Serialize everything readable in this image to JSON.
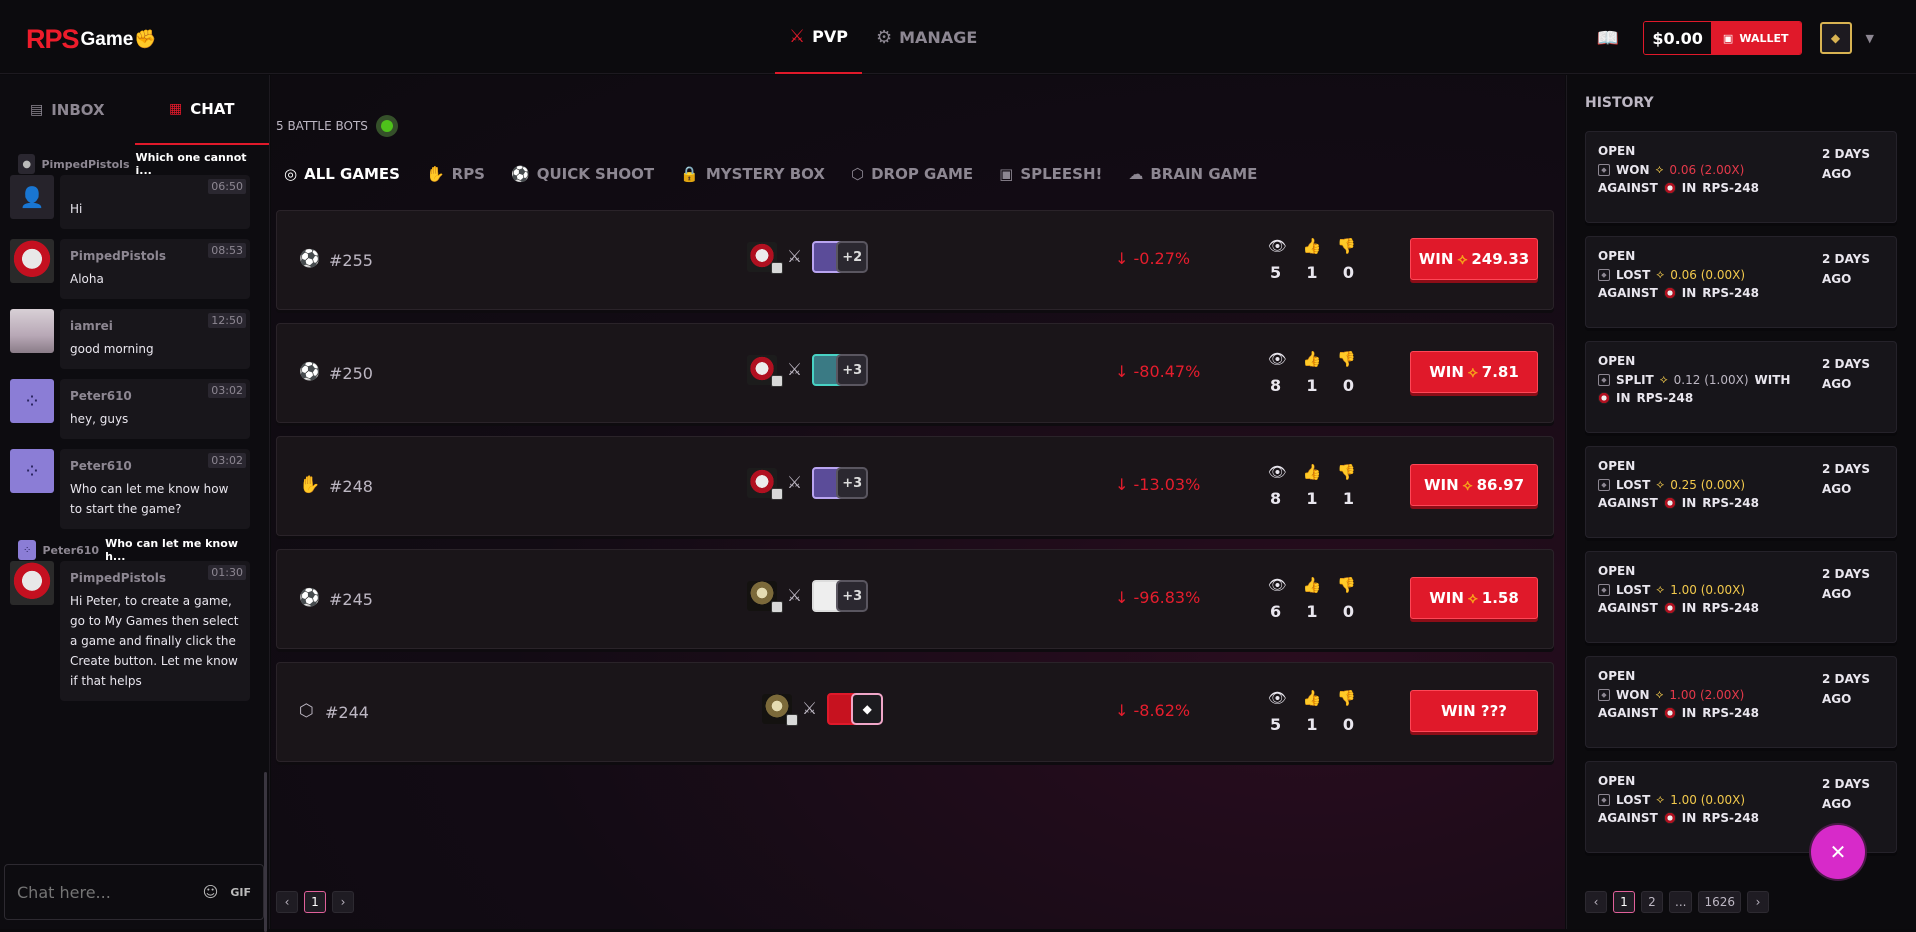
{
  "logo": {
    "rps": "RPS",
    "game": "Game"
  },
  "nav": {
    "pvp": "PVP",
    "manage": "MANAGE"
  },
  "wallet": {
    "balance": "$0.00",
    "label": "WALLET"
  },
  "left": {
    "tabs": {
      "inbox": "INBOX",
      "chat": "CHAT"
    },
    "messages": [
      {
        "reply_name": "PimpedPistols",
        "reply_text": "Which one cannot i...",
        "name": "",
        "text": "Hi",
        "time": "06:50",
        "avatar": "gray"
      },
      {
        "name": "PimpedPistols",
        "text": "Aloha",
        "time": "08:53",
        "avatar": "rb"
      },
      {
        "name": "iamrei",
        "text": "good morning",
        "time": "12:50",
        "avatar": "photo"
      },
      {
        "name": "Peter610",
        "text": "hey, guys",
        "time": "03:02",
        "avatar": "purple"
      },
      {
        "name": "Peter610",
        "text": "Who can let me know how to start the game?",
        "time": "03:02",
        "avatar": "purple"
      },
      {
        "reply_name": "Peter610",
        "reply_text": "Who can let me know h...",
        "name": "PimpedPistols",
        "text": "Hi Peter, to create a game, go to My Games then select a game and finally click the Create button. Let me know if that helps",
        "time": "01:30",
        "avatar": "rb"
      }
    ],
    "input_placeholder": "Chat here...",
    "gif": "GIF"
  },
  "main": {
    "bots_label": "5 BATTLE BOTS",
    "tabs": [
      "ALL GAMES",
      "RPS",
      "QUICK SHOOT",
      "MYSTERY BOX",
      "DROP GAME",
      "SPLEESH!",
      "BRAIN GAME"
    ],
    "games": [
      {
        "id": "#255",
        "more": "+2",
        "pct": "-0.27%",
        "views": "5",
        "likes": "1",
        "dislikes": "0",
        "win": "WIN",
        "amount": "249.33"
      },
      {
        "id": "#250",
        "more": "+3",
        "pct": "-80.47%",
        "views": "8",
        "likes": "1",
        "dislikes": "0",
        "win": "WIN",
        "amount": "7.81"
      },
      {
        "id": "#248",
        "more": "+3",
        "pct": "-13.03%",
        "views": "8",
        "likes": "1",
        "dislikes": "1",
        "win": "WIN",
        "amount": "86.97"
      },
      {
        "id": "#245",
        "more": "+3",
        "pct": "-96.83%",
        "views": "6",
        "likes": "1",
        "dislikes": "0",
        "win": "WIN",
        "amount": "1.58"
      },
      {
        "id": "#244",
        "more": "",
        "pct": "-8.62%",
        "views": "5",
        "likes": "1",
        "dislikes": "0",
        "win": "WIN ???",
        "amount": ""
      }
    ],
    "pager": {
      "prev": "‹",
      "page": "1",
      "next": "›"
    }
  },
  "history": {
    "title": "HISTORY",
    "items": [
      {
        "status": "OPEN",
        "result": "WON",
        "amount": "0.06 (2.00X)",
        "tone": "red",
        "ago1": "2 DAYS",
        "ago2": "AGO",
        "against": "AGAINST",
        "in": "IN",
        "game": "RPS-248"
      },
      {
        "status": "OPEN",
        "result": "LOST",
        "amount": "0.06 (0.00X)",
        "tone": "yel",
        "ago1": "2 DAYS",
        "ago2": "AGO",
        "against": "AGAINST",
        "in": "IN",
        "game": "RPS-248"
      },
      {
        "status": "OPEN",
        "result": "SPLIT",
        "amount": "0.12 (1.00X)",
        "with": "WITH",
        "tone": "gray",
        "ago1": "2 DAYS",
        "ago2": "AGO",
        "in": "IN",
        "game": "RPS-248"
      },
      {
        "status": "OPEN",
        "result": "LOST",
        "amount": "0.25 (0.00X)",
        "tone": "yel",
        "ago1": "2 DAYS",
        "ago2": "AGO",
        "against": "AGAINST",
        "in": "IN",
        "game": "RPS-248"
      },
      {
        "status": "OPEN",
        "result": "LOST",
        "amount": "1.00 (0.00X)",
        "tone": "yel",
        "ago1": "2 DAYS",
        "ago2": "AGO",
        "against": "AGAINST",
        "in": "IN",
        "game": "RPS-248"
      },
      {
        "status": "OPEN",
        "result": "WON",
        "amount": "1.00 (2.00X)",
        "tone": "red",
        "ago1": "2 DAYS",
        "ago2": "AGO",
        "against": "AGAINST",
        "in": "IN",
        "game": "RPS-248"
      },
      {
        "status": "OPEN",
        "result": "LOST",
        "amount": "1.00 (0.00X)",
        "tone": "yel",
        "ago1": "2 DAYS",
        "ago2": "AGO",
        "against": "AGAINST",
        "in": "IN",
        "game": "RPS-248"
      }
    ],
    "pager": {
      "prev": "‹",
      "p1": "1",
      "p2": "2",
      "dots": "...",
      "last": "1626",
      "next": "›"
    }
  }
}
